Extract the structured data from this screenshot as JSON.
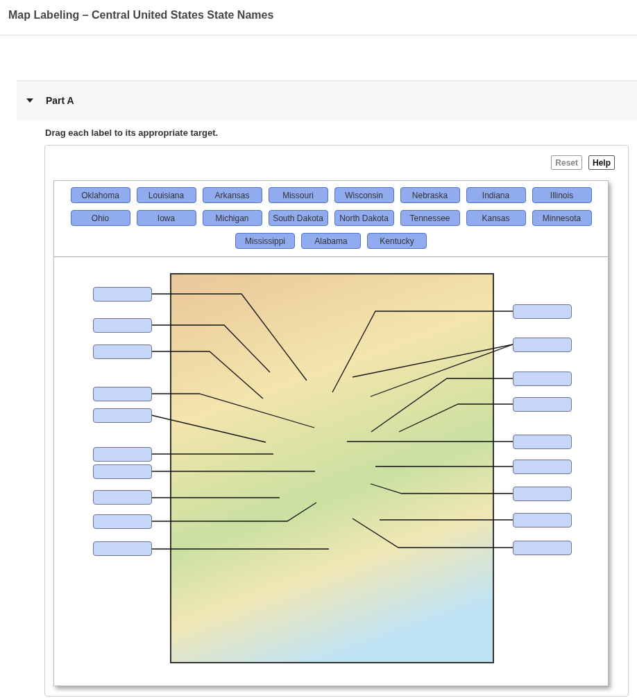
{
  "title": "Map Labeling – Central United States State Names",
  "part": {
    "label": "Part A",
    "expanded": true
  },
  "instruction": "Drag each label to its appropriate target.",
  "buttons": [
    {
      "label": "Reset",
      "disabled": true
    },
    {
      "label": "Help",
      "disabled": false
    }
  ],
  "labels": [
    "Oklahoma",
    "Louisiana",
    "Arkansas",
    "Missouri",
    "Wisconsin",
    "Nebraska",
    "Indiana",
    "Illinois",
    "Ohio",
    "Iowa",
    "Michigan",
    "South Dakota",
    "North Dakota",
    "Tennessee",
    "Kansas",
    "Minnesota",
    "Mississippi",
    "Alabama",
    "Kentucky"
  ],
  "targets": [
    {
      "kind": "left"
    },
    {
      "kind": "left"
    },
    {
      "kind": "left"
    },
    {
      "kind": "left"
    },
    {
      "kind": "left"
    },
    {
      "kind": "left"
    },
    {
      "kind": "left"
    },
    {
      "kind": "left"
    },
    {
      "kind": "left"
    },
    {
      "kind": "left"
    },
    {
      "kind": "right"
    },
    {
      "kind": "right"
    },
    {
      "kind": "right"
    },
    {
      "kind": "right"
    },
    {
      "kind": "right"
    },
    {
      "kind": "right"
    },
    {
      "kind": "right"
    },
    {
      "kind": "right"
    },
    {
      "kind": "right"
    }
  ]
}
